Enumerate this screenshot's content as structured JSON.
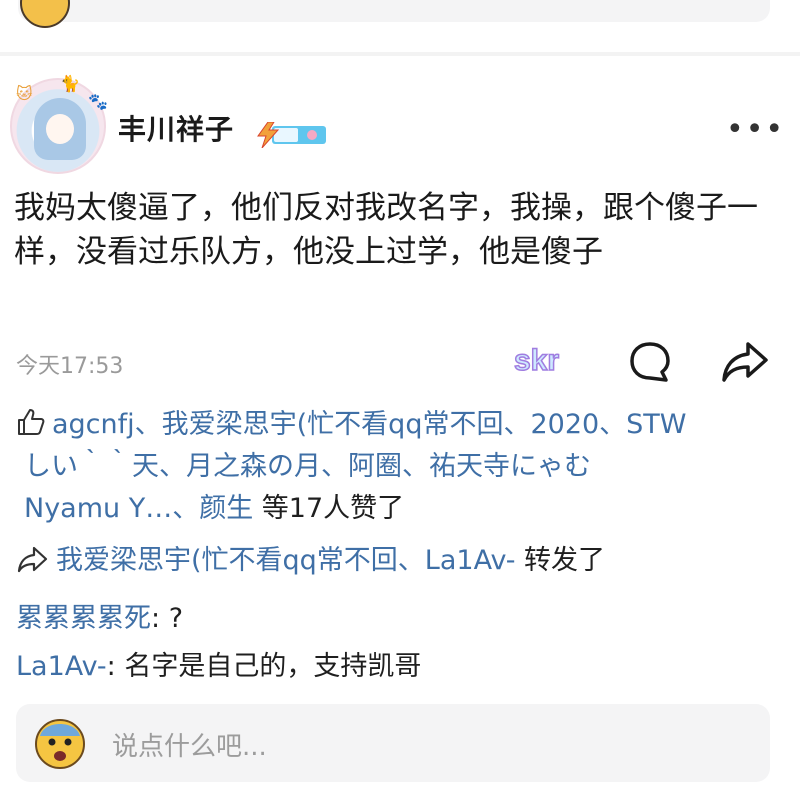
{
  "post": {
    "username": "丰川祥子",
    "content": "我妈太傻逼了，他们反对我改名字，我操，跟个傻子一样，没看过乐队方，他没上过学，他是傻子",
    "time": "今天17:53",
    "skr_label": "skr"
  },
  "likes": {
    "line1_names": "agcnfj、我爱梁思宇(忙不看qq常不回、2020、STW",
    "line2_names": "しい｀｀天、月之森の月、阿圈、祐天寺にゃむ",
    "line3_names": "Nyamu Y…、颜生",
    "suffix": " 等17人赞了"
  },
  "reposts": {
    "names": "我爱梁思宇(忙不看qq常不回、La1Av-",
    "suffix": " 转发了"
  },
  "comments": [
    {
      "author": "累累累累死",
      "separator": ": ",
      "text": "?"
    },
    {
      "author": "La1Av-",
      "separator": ": ",
      "text": "名字是自己的，支持凯哥"
    }
  ],
  "input": {
    "placeholder": "说点什么吧..."
  },
  "colors": {
    "link_blue": "#3f6fa6",
    "card_bg": "#f4f4f5",
    "time_gray": "#9a9a9a"
  }
}
